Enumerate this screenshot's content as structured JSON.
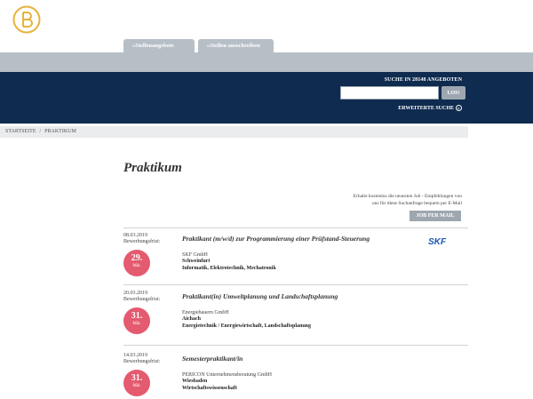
{
  "brand": {
    "logo_icon": "circle-b-logo-icon",
    "accent": "#e7b33b"
  },
  "colors": {
    "navy": "#0f2b4f",
    "grey": "#b7bfc6",
    "badge": "#e45a6f",
    "skf": "#1a57b4"
  },
  "tabs": [
    {
      "label": "»Stellenangebote"
    },
    {
      "label": "»Stellen ausschreiben"
    }
  ],
  "search": {
    "caption": "SUCHE IN 28148 ANGEBOTEN",
    "value": "",
    "button_label": "LOS!",
    "advanced_label": "ERWEITERTE SUCHE"
  },
  "breadcrumb": {
    "home": "STARTSEITE",
    "separator": "/",
    "current": "PRAKTIKUM"
  },
  "page": {
    "title": "Praktikum",
    "promo_line1": "Erhalte kostenlos die neuesten Job - Empfehlungen von",
    "promo_line2": "uns für diese Suchanfrage bequem per E-Mail",
    "jobmail_label": "JOB PER MAIL"
  },
  "jobs": [
    {
      "date": "08.03.2019",
      "deadline_label": "Bewerbungsfrist:",
      "deadline_day": "29.",
      "deadline_month": "Mär.",
      "title": "Praktikant (m/w/d) zur Programmierung einer Prüfstand-Steuerung",
      "company": "SKF GmbH",
      "city": "Schweinfurt",
      "categories": "Informatik, Elektrotechnik, Mechatronik",
      "logo_text": "SKF"
    },
    {
      "date": "20.03.2019",
      "deadline_label": "Bewerbungsfrist:",
      "deadline_day": "31.",
      "deadline_month": "Mär.",
      "title": "Praktikant(in) Umweltplanung und Landschaftsplanung",
      "company": "Energiebauern GmbH",
      "city": "Aichach",
      "categories": "Energietechnik / Energiewirtschaft, Landschaftsplanung"
    },
    {
      "date": "14.03.2019",
      "deadline_label": "Bewerbungsfrist:",
      "deadline_day": "31.",
      "deadline_month": "Mär.",
      "title": "Semesterpraktikant/in",
      "company": "PERICON Unternehmensberatung GmbH",
      "city": "Wiesbaden",
      "categories": "Wirtschaftswissenschaft"
    }
  ]
}
